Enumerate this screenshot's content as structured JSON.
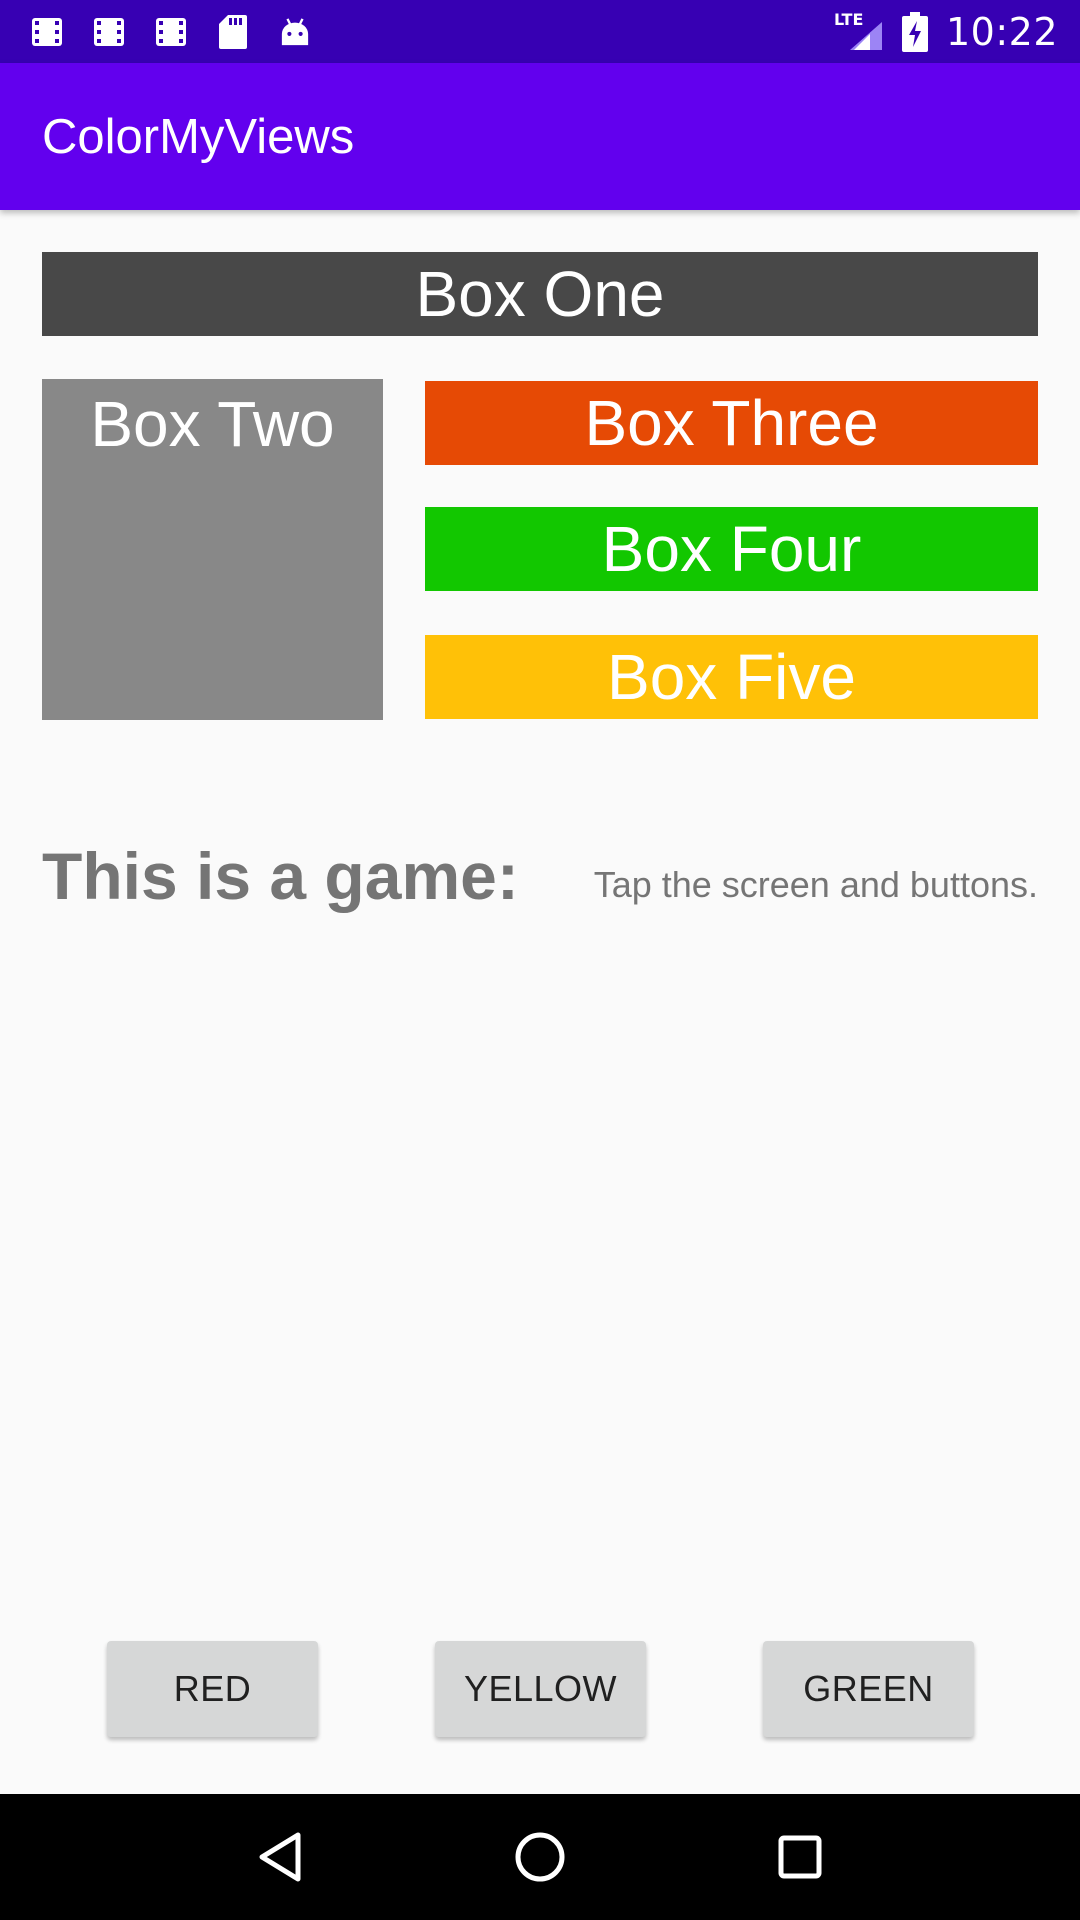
{
  "status_bar": {
    "time": "10:22",
    "network": "LTE",
    "left_icons": [
      "film-icon",
      "film-icon",
      "film-icon",
      "sd-card-icon",
      "android-icon"
    ],
    "right_icons": [
      "signal-icon",
      "battery-charging-icon"
    ]
  },
  "app_bar": {
    "title": "ColorMyViews",
    "color": "#6200EE"
  },
  "boxes": {
    "one": {
      "label": "Box One",
      "color": "#484848"
    },
    "two": {
      "label": "Box Two",
      "color": "#888888"
    },
    "three": {
      "label": "Box Three",
      "color": "#E64A05"
    },
    "four": {
      "label": "Box Four",
      "color": "#12C700"
    },
    "five": {
      "label": "Box Five",
      "color": "#FFC107"
    }
  },
  "labels": {
    "game": "This is a game:",
    "instructions": "Tap the screen and buttons."
  },
  "buttons": {
    "red": "RED",
    "yellow": "YELLOW",
    "green": "GREEN"
  },
  "nav_bar": {
    "icons": [
      "back-icon",
      "home-icon",
      "recents-icon"
    ]
  }
}
